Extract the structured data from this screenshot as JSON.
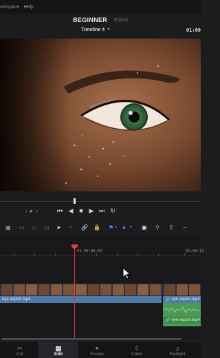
{
  "menu": {
    "items": [
      "orkspace",
      "Help"
    ]
  },
  "project": {
    "title": "BEGINNER",
    "status": "Edited"
  },
  "timeline": {
    "name": "Timeline 4",
    "timecode": "01:00"
  },
  "ruler": {
    "tc1": "01:00:08:00",
    "tc2": "01:00:12"
  },
  "clips": {
    "v1_name": "eye export.mp4",
    "v2_name": "eye export.mp4",
    "a1_name": "eye export.mp4"
  },
  "pages": [
    {
      "label": "Cut",
      "icon": "cut-page-icon"
    },
    {
      "label": "Edit",
      "icon": "edit-page-icon"
    },
    {
      "label": "Fusion",
      "icon": "fusion-page-icon"
    },
    {
      "label": "Color",
      "icon": "color-page-icon"
    },
    {
      "label": "Fairlight",
      "icon": "fairlight-page-icon"
    }
  ],
  "active_page": "Edit",
  "colors": {
    "playhead": "#e03c3c",
    "video_clip": "#4f7aa8",
    "audio_clip": "#4a9a55",
    "accent_blue": "#4a8df0"
  }
}
